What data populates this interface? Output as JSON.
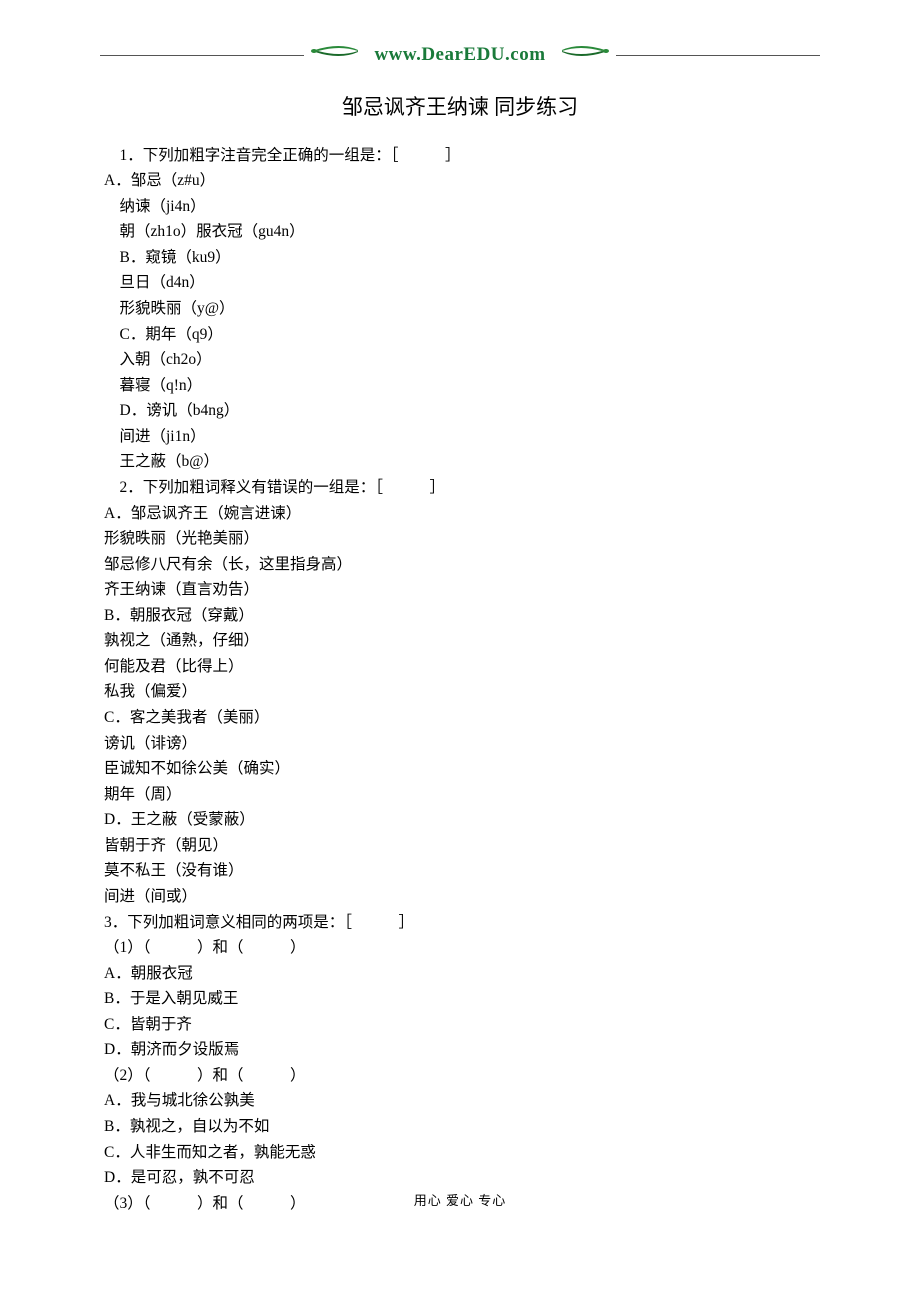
{
  "header": {
    "url_prefix": "www.",
    "url_mid": "DearEDU",
    "url_suffix": ".com"
  },
  "title": "邹忌讽齐王纳谏  同步练习",
  "content": {
    "q1": {
      "prompt": "　1．下列加粗字注音完全正确的一组是：［　　　］",
      "opts": [
        "A．邹忌（z#u）",
        "　纳谏（ji4n）",
        "　朝（zh1o）服衣冠（gu4n）",
        "　B．窥镜（ku9）",
        "　旦日（d4n）",
        "　形貌昳丽（y@）",
        "　C．期年（q9）",
        "　入朝（ch2o）",
        "　暮寝（q!n）",
        "　D．谤讥（b4ng）",
        "　间进（ji1n）",
        "　王之蔽（b@）"
      ]
    },
    "q2": {
      "prompt": "　2．下列加粗词释义有错误的一组是：［　　　］",
      "opts": [
        "A．邹忌讽齐王（婉言进谏）",
        "形貌昳丽（光艳美丽）",
        "邹忌修八尺有余（长，这里指身高）",
        "齐王纳谏（直言劝告）",
        "B．朝服衣冠（穿戴）",
        "孰视之（通熟，仔细）",
        "何能及君（比得上）",
        "私我（偏爱）",
        "C．客之美我者（美丽）",
        "谤讥（诽谤）",
        "臣诚知不如徐公美（确实）",
        "期年（周）",
        "D．王之蔽（受蒙蔽）",
        "皆朝于齐（朝见）",
        "莫不私王（没有谁）",
        "间进（间或）"
      ]
    },
    "q3": {
      "prompt": "3．下列加粗词意义相同的两项是：［　　　］",
      "sub1": {
        "head": "（1）（　　　）和（　　　）",
        "opts": [
          "A．朝服衣冠",
          "B．于是入朝见威王",
          "C．皆朝于齐",
          "D．朝济而夕设版焉"
        ]
      },
      "sub2": {
        "head": "（2）（　　　）和（　　　）",
        "opts": [
          "A．我与城北徐公孰美",
          "B．孰视之，自以为不如",
          "C．人非生而知之者，孰能无惑",
          "D．是可忍，孰不可忍"
        ]
      },
      "sub3": {
        "head": "（3）（　　　）和（　　　）"
      }
    }
  },
  "footer": "用心  爱心  专心"
}
